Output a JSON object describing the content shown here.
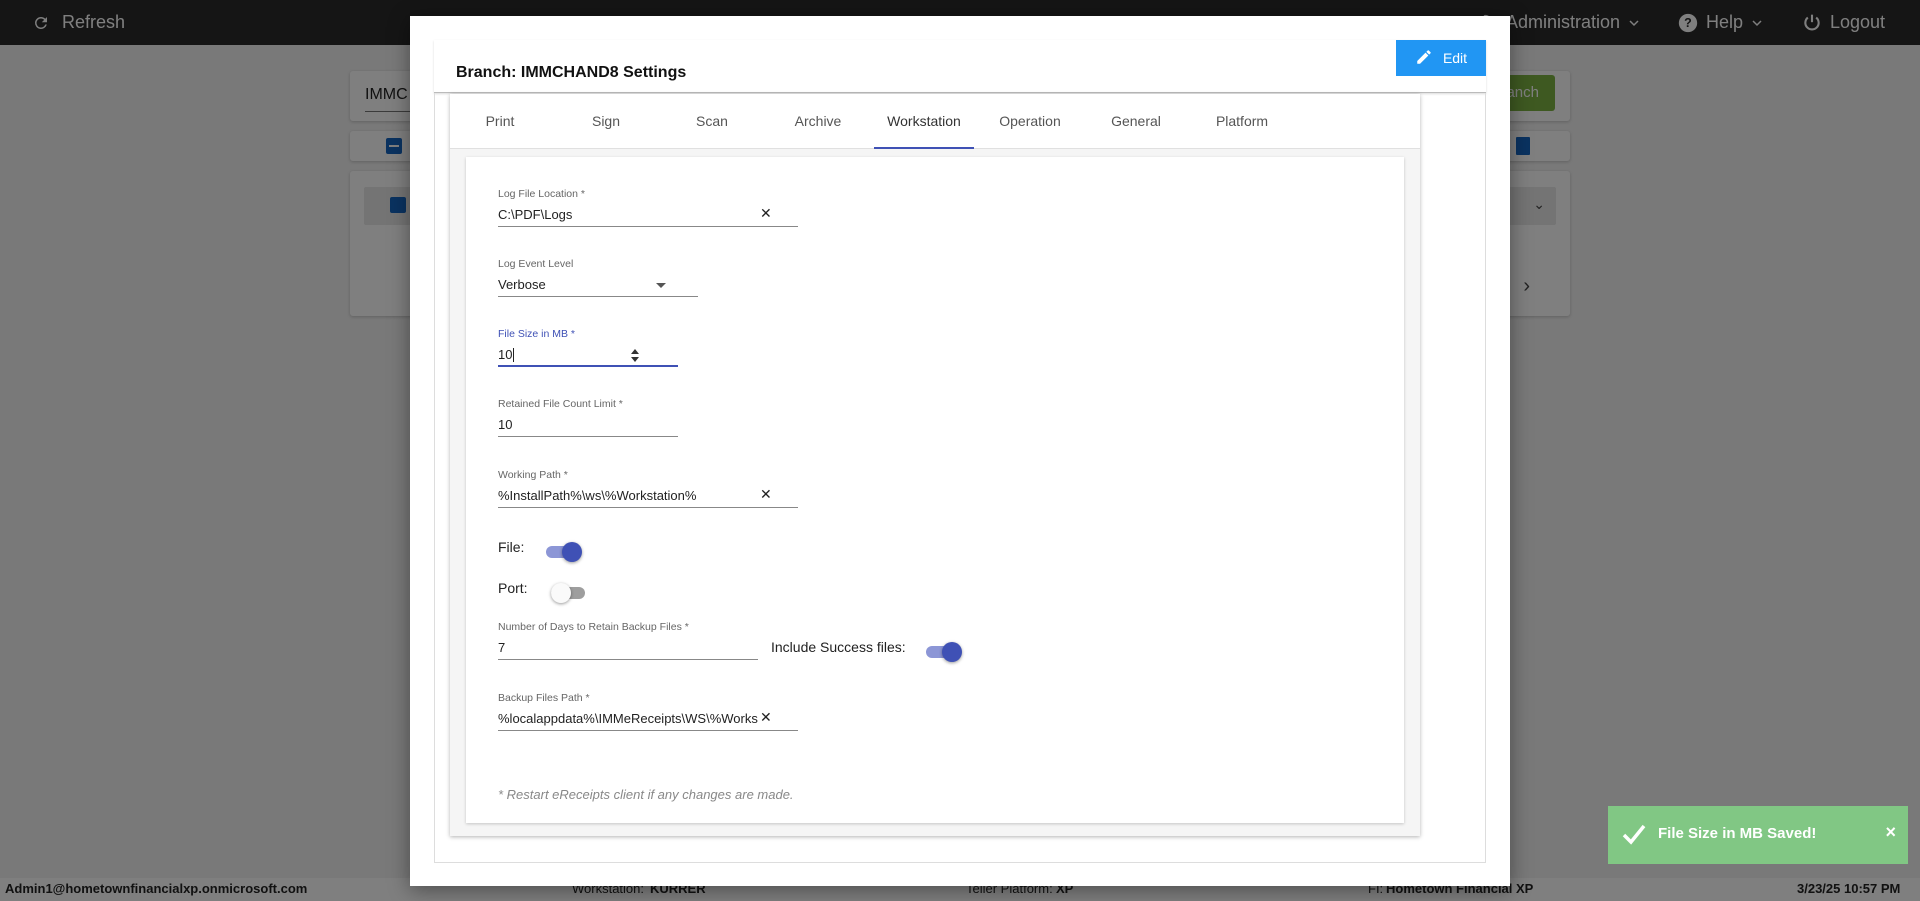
{
  "topbar": {
    "refresh_label": "Refresh",
    "administration_label": "Administration",
    "help_label": "Help",
    "logout_label": "Logout"
  },
  "background": {
    "search_partial": "IMMC",
    "branch_button_partial": "anch",
    "status": {
      "user": "Admin1@hometownfinancialxp.onmicrosoft.com",
      "workstation_label": "Workstation:",
      "workstation_value": "KURRER",
      "teller_label": "Teller Platform:",
      "teller_value": "XP",
      "fi_label": "FI:",
      "fi_value": "Hometown Financial XP",
      "datetime": "3/23/25 10:57 PM"
    }
  },
  "modal": {
    "title": "Branch: IMMCHAND8 Settings",
    "edit_label": "Edit",
    "tabs": [
      "Print",
      "Sign",
      "Scan",
      "Archive",
      "Workstation",
      "Operation",
      "General",
      "Platform"
    ],
    "active_tab": "Workstation",
    "form": {
      "log_file_location": {
        "label": "Log File Location *",
        "value": "C:\\PDF\\Logs"
      },
      "log_event_level": {
        "label": "Log Event Level",
        "value": "Verbose"
      },
      "file_size": {
        "label": "File Size in MB *",
        "value": "10"
      },
      "retained_count": {
        "label": "Retained File Count Limit *",
        "value": "10"
      },
      "working_path": {
        "label": "Working Path *",
        "value": "%InstallPath%\\ws\\%Workstation%"
      },
      "file_toggle": {
        "label": "File:",
        "on": true
      },
      "port_toggle": {
        "label": "Port:",
        "on": false
      },
      "retain_days": {
        "label": "Number of Days to Retain Backup Files *",
        "value": "7"
      },
      "include_success": {
        "label": "Include Success files:",
        "on": true
      },
      "backup_path": {
        "label": "Backup Files Path *",
        "value": "%localappdata%\\IMMeReceipts\\WS\\%Works"
      },
      "note": "* Restart eReceipts client if any changes are made."
    }
  },
  "toast": {
    "message": "File Size in MB Saved!",
    "close": "×"
  },
  "colors": {
    "accent": "#3f51b5",
    "edit_button": "#2196f3",
    "toast": "#81c784",
    "topbar": "#2b2b2b"
  }
}
